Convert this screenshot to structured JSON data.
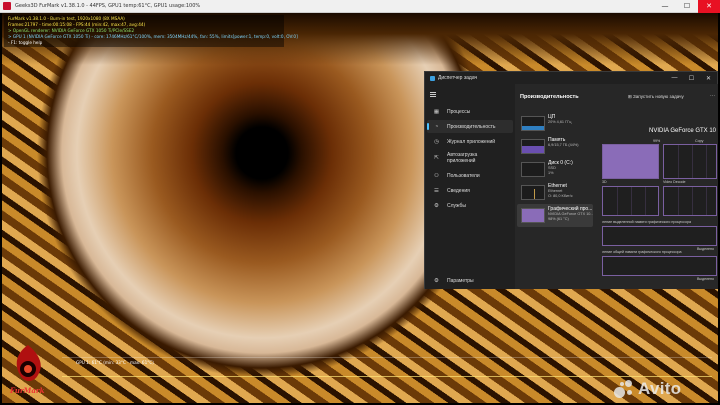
{
  "furmark_window": {
    "title": "Geeks3D FurMark v1.38.1.0 - 44FPS, GPU1 temp:61°C, GPU1 usage:100%",
    "controls": [
      "—",
      "☐",
      "✕"
    ]
  },
  "overlay": {
    "lines": [
      "FurMark v1.38.1.0 - Burn-in test, 1920x1080 (8X MSAA)",
      "Frames:21797 - time:00:15:08 - FPS:44 (min:42, max:47, avg:44)",
      "> OpenGL renderer: NVIDIA GeForce GTX 1050 Ti/PCIe/SSE2",
      "> GPU 1 (NVIDIA GeForce GTX 1050 Ti) - core: 1746MHz/61°C/100%, mem: 3504MHz/44%, fan: 55%, limits[power:1, temp:0, volt:0, OV:0]",
      "- F1: toggle help"
    ],
    "graph_text": "GPU 1: 61°C (min: 33°C - max: 61°C)"
  },
  "branding": {
    "furmark_logo_text": "FurMark",
    "watermark": "Avito"
  },
  "task_manager": {
    "title": "Диспетчер задач",
    "controls": [
      "—",
      "☐",
      "✕"
    ],
    "nav": [
      {
        "icon": "▦",
        "label": "Процессы"
      },
      {
        "icon": "◔",
        "label": "Производительность"
      },
      {
        "icon": "◷",
        "label": "Журнал приложений"
      },
      {
        "icon": "⇱",
        "label": "Автозагрузка приложений"
      },
      {
        "icon": "⚇",
        "label": "Пользователи"
      },
      {
        "icon": "☰",
        "label": "Сведения"
      },
      {
        "icon": "⚙",
        "label": "Службы"
      }
    ],
    "settings_label": "Параметры",
    "header": "Производительность",
    "new_task": "Запустить новую задачу",
    "more": "···",
    "devices": [
      {
        "name": "ЦП",
        "sub1": "20%  4,61 ГГц",
        "sub2": ""
      },
      {
        "name": "Память",
        "sub1": "6,9/15,7 ГБ (44%)",
        "sub2": ""
      },
      {
        "name": "Диск 0 (C:)",
        "sub1": "SSD",
        "sub2": "1%"
      },
      {
        "name": "Ethernet",
        "sub1": "Ethernet",
        "sub2": "О: 80,0 Кбит/с"
      },
      {
        "name": "Графический про...",
        "sub1": "NVIDIA GeForce GTX 10...",
        "sub2": "98% (61 °C)"
      }
    ],
    "gpu_panel": {
      "title": "NVIDIA GeForce GTX 10",
      "labels": [
        "99%",
        "Copy",
        "3D",
        "Video Decode",
        "ление выделенной памяти графического процессора",
        "ление общей памяти графического процессора",
        "Выделено",
        "Выделено"
      ],
      "usage_fraction": 0.99
    }
  }
}
